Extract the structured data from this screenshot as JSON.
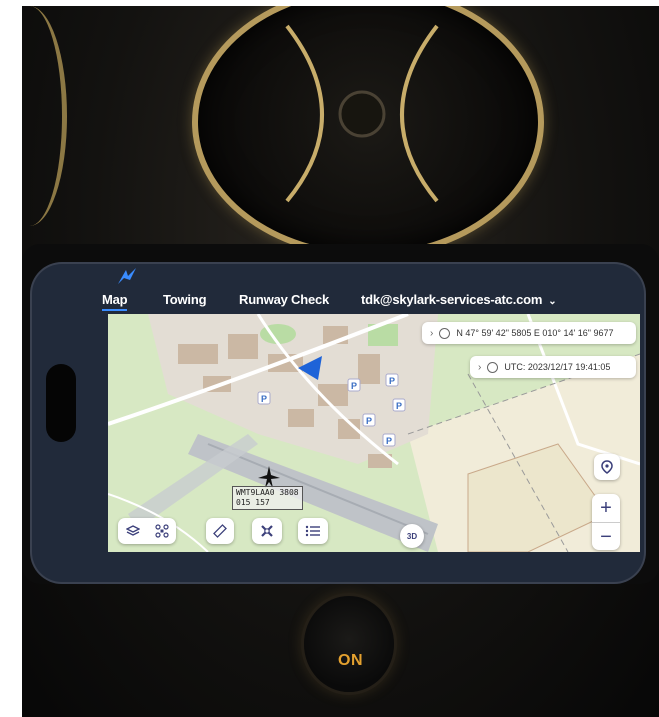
{
  "nav": {
    "items": [
      "Map",
      "Towing",
      "Runway Check"
    ],
    "active": "Map",
    "account": "tdk@skylark-services-atc.com"
  },
  "position_panel": {
    "icon": "compass-icon",
    "text": "N 47° 59' 42\" 5805  E 010° 14' 16\" 9677"
  },
  "time_panel": {
    "icon": "clock-icon",
    "text": "UTC:  2023/12/17  19:41:05"
  },
  "aircraft": {
    "label_line1": "WMT9LAA0 3808",
    "label_line2": "015 157"
  },
  "map_controls": {
    "view3d": "3D",
    "zoom_in": "+",
    "zoom_out": "−"
  },
  "toolbar_icons": [
    "layers-icon",
    "drone-icon",
    "ruler-icon",
    "no-fly-icon",
    "list-icon"
  ],
  "console": {
    "button_label": "ON"
  },
  "colors": {
    "accent": "#3a8cff",
    "map_background": "#d7e8c3",
    "icon_color": "#3b3f7a",
    "on_label": "#e4a12f"
  }
}
